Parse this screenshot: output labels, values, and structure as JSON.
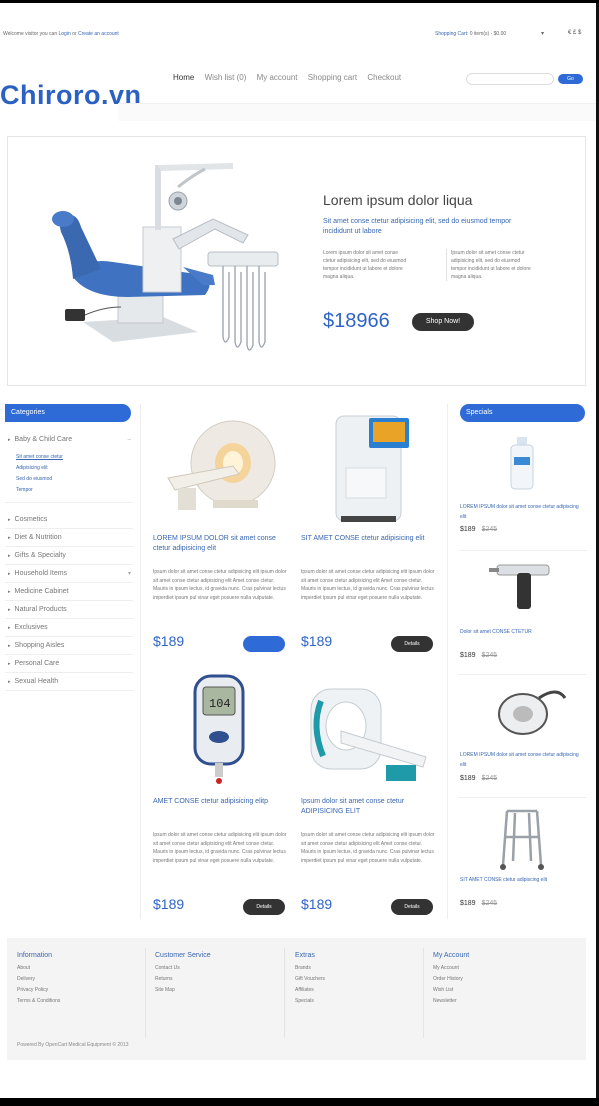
{
  "topbar": {
    "welcome_prefix": "Welcome visitor you can ",
    "login": "Login",
    "or": " or ",
    "create_account": "Create an account",
    "cart_label": "Shopping Cart",
    "cart_value": ": 0 item(s) - $0.00",
    "lang": "€ £ $"
  },
  "logo": "Chiroro.vn",
  "nav": {
    "items": [
      "Home",
      "Wish list (0)",
      "My account",
      "Shopping cart",
      "Checkout"
    ],
    "search_placeholder": "",
    "go_label": "Go"
  },
  "hero": {
    "title": "Lorem ipsum dolor liqua",
    "subtitle": "Sit amet conse ctetur adipisicing elit, sed do eiusmod tempor incididunt ut labore",
    "col1": "Lorem ipsum dolor sit amet conse ctetur adipisicing elit, sed do eiusmod tempor incididunt ut labore et dolore magna aliqua.",
    "col2": "Ipsum dolor sit amet conse ctetur adipisicing elit, sed do eiusmod tempor incididunt ut labore et dolore magna aliqua.",
    "price": "$18966",
    "button": "Shop Now!"
  },
  "sidebar": {
    "title": "Categories",
    "first_item": "Baby & Child Care",
    "subitems": [
      "Sit amet conse ctetur",
      "Adipisicing elit",
      "Sed do eiusmod",
      "Tempor"
    ],
    "items": [
      "Cosmetics",
      "Diet & Nutrition",
      "Gifts & Specialty",
      "Household Items",
      "Medicine Cabinet",
      "Natural Products",
      "Exclusives",
      "Shopping Aisles",
      "Personal Care",
      "Sexual Health"
    ]
  },
  "products": [
    {
      "name": "LOREM IPSUM DOLOR sit amet conse ctetur adipisicing elit",
      "desc": "Ipsum dolor sit amet conse ctetur adipisicing elit ipsum dolor sit amet conse ctetur adipisicing elit Amet conse ctetur. Mauris in ipsum lectus, id gravida nunc. Cras pulvinar lectus imperdiet ipsum pul vinar eget posuere nulla vulputate.",
      "price": "$189",
      "button": ""
    },
    {
      "name": "SIT AMET CONSE ctetur adipisicing elit",
      "desc": "Ipsum dolor sit amet conse ctetur adipisicing elit ipsum dolor sit amet conse ctetur adipisicing elit Amet conse ctetur. Mauris in ipsum lectus, id gravida nunc. Cras pulvinar lectus imperdiet ipsum pul vinar eget posuere nulla vulputate.",
      "price": "$189",
      "button": "Details"
    },
    {
      "name": "AMET CONSE ctetur adipisicing elitp",
      "desc": "Ipsum dolor sit amet conse ctetur adipisicing elit ipsum dolor sit amet conse ctetur adipisicing elit Amet conse ctetur. Mauris in ipsum lectus, id gravida nunc. Cras pulvinar lectus imperdiet ipsum pul vinar eget posuere nulla vulputate.",
      "price": "$189",
      "button": "Details"
    },
    {
      "name": "Ipsum dolor sit amet conse ctetur ADIPISICING ELIT",
      "desc": "Ipsum dolor sit amet conse ctetur adipisicing elit ipsum dolor sit amet conse ctetur adipisicing elit Amet conse ctetur. Mauris in ipsum lectus, id gravida nunc. Cras pulvinar lectus imperdiet ipsum pul vinar eget posuere nulla vulputate.",
      "price": "$189",
      "button": "Details"
    }
  ],
  "specials": {
    "title": "Specials",
    "items": [
      {
        "name": "LOREM IPSUM dolor sit amet conse ctetur adipiscing elit",
        "price": "$189",
        "old_price": "$245"
      },
      {
        "name": "Dolor sit amet CONSE CTETUR",
        "price": "$189",
        "old_price": "$245"
      },
      {
        "name": "LOREM IPSUM dolor sit amet conse ctetur adipiscing elit",
        "price": "$189",
        "old_price": "$245"
      },
      {
        "name": "SIT AMET CONSE ctetur adipiscing elit",
        "price": "$189",
        "old_price": "$245"
      }
    ]
  },
  "footer": {
    "columns": [
      {
        "title": "Information",
        "links": [
          "About",
          "Delivery",
          "Privacy Policy",
          "Terms & Conditions"
        ]
      },
      {
        "title": "Customer Service",
        "links": [
          "Contact Us",
          "Returns",
          "Site Map"
        ]
      },
      {
        "title": "Extras",
        "links": [
          "Brands",
          "Gift Vouchers",
          "Affiliates",
          "Specials"
        ]
      },
      {
        "title": "My Account",
        "links": [
          "My Account",
          "Order History",
          "Wish List",
          "Newsletter"
        ]
      }
    ],
    "powered": "Powered By OpenCart Medical Equipment © 2013"
  },
  "colors": {
    "accent": "#2e6bd6",
    "link": "#3866b3",
    "dark_button": "#333333"
  }
}
